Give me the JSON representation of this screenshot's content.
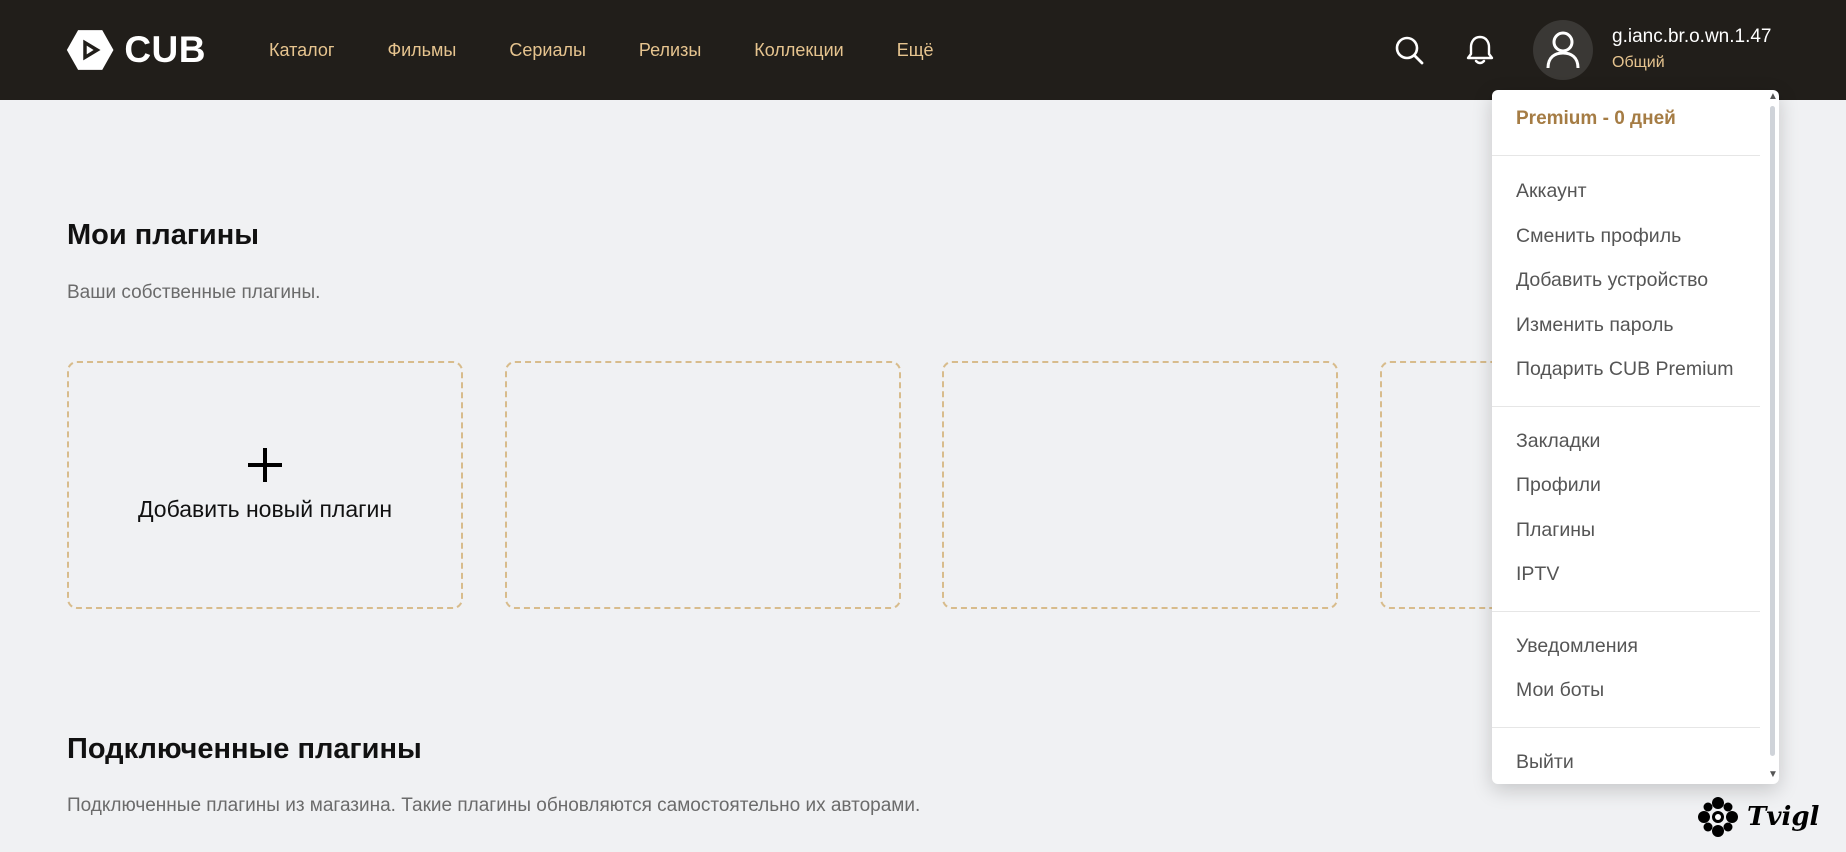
{
  "brand": {
    "name": "CUB",
    "colors": {
      "header_bg": "#211e1a",
      "accent": "#e6c48f",
      "premium": "#a57c44"
    }
  },
  "nav": [
    {
      "label": "Каталог"
    },
    {
      "label": "Фильмы"
    },
    {
      "label": "Сериалы"
    },
    {
      "label": "Релизы"
    },
    {
      "label": "Коллекции"
    },
    {
      "label": "Ещё"
    }
  ],
  "header_icons": {
    "search": "search-icon",
    "notifications": "bell-icon",
    "avatar": "user-icon"
  },
  "user": {
    "name": "g.ianc.br.o.wn.1.47",
    "role": "Общий"
  },
  "my_plugins": {
    "title": "Мои плагины",
    "description": "Ваши собственные плагины.",
    "add_label": "Добавить новый плагин"
  },
  "connected_plugins": {
    "title": "Подключенные плагины",
    "description": "Подключенные плагины из магазина. Такие плагины обновляются самостоятельно их авторами."
  },
  "dropdown": {
    "premium": "Premium - 0 дней",
    "group1": [
      "Аккаунт",
      "Сменить профиль",
      "Добавить устройство",
      "Изменить пароль",
      "Подарить CUB Premium"
    ],
    "group2": [
      "Закладки",
      "Профили",
      "Плагины",
      "IPTV"
    ],
    "group3": [
      "Уведомления",
      "Мои боты"
    ],
    "logout": "Выйти"
  },
  "watermark": {
    "text": "Tvigl"
  }
}
